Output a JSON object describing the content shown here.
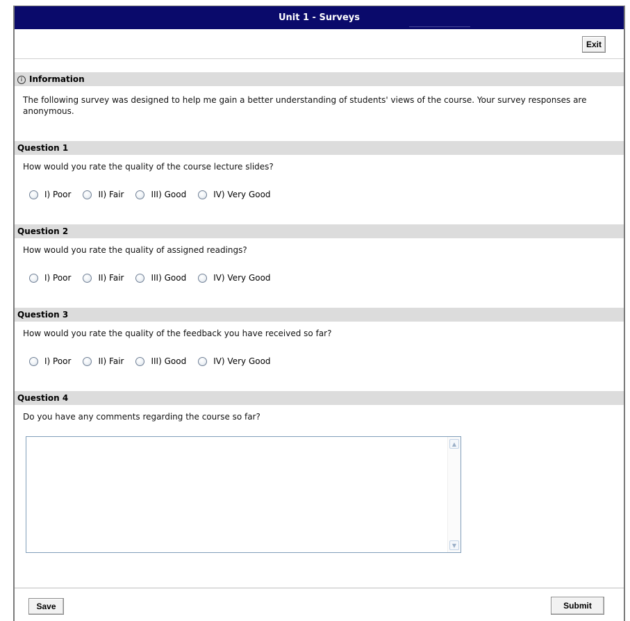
{
  "window": {
    "title": "Unit 1 - Surveys"
  },
  "toolbar": {
    "exit_label": "Exit"
  },
  "information": {
    "icon": "info-icon",
    "heading": "Information",
    "text": "The following survey was designed to help me gain a better understanding of students' views of the course. Your survey responses are anonymous."
  },
  "questions": [
    {
      "heading": "Question 1",
      "text": "How would you rate the quality of the course lecture slides?",
      "options": [
        "I) Poor",
        "II) Fair",
        "III) Good",
        "IV) Very Good"
      ]
    },
    {
      "heading": "Question 2",
      "text": "How would you rate the quality of assigned readings?",
      "options": [
        "I) Poor",
        "II) Fair",
        "III) Good",
        "IV) Very Good"
      ]
    },
    {
      "heading": "Question 3",
      "text": "How would you rate the quality of the feedback you have received so far?",
      "options": [
        "I) Poor",
        "II) Fair",
        "III) Good",
        "IV) Very Good"
      ]
    },
    {
      "heading": "Question 4",
      "text": "Do you have any comments regarding the course so far?",
      "answer": ""
    }
  ],
  "footer": {
    "save_label": "Save",
    "submit_label": "Submit"
  },
  "colors": {
    "titlebar": "#0a0a6b",
    "section_header": "#dcdcdc"
  }
}
